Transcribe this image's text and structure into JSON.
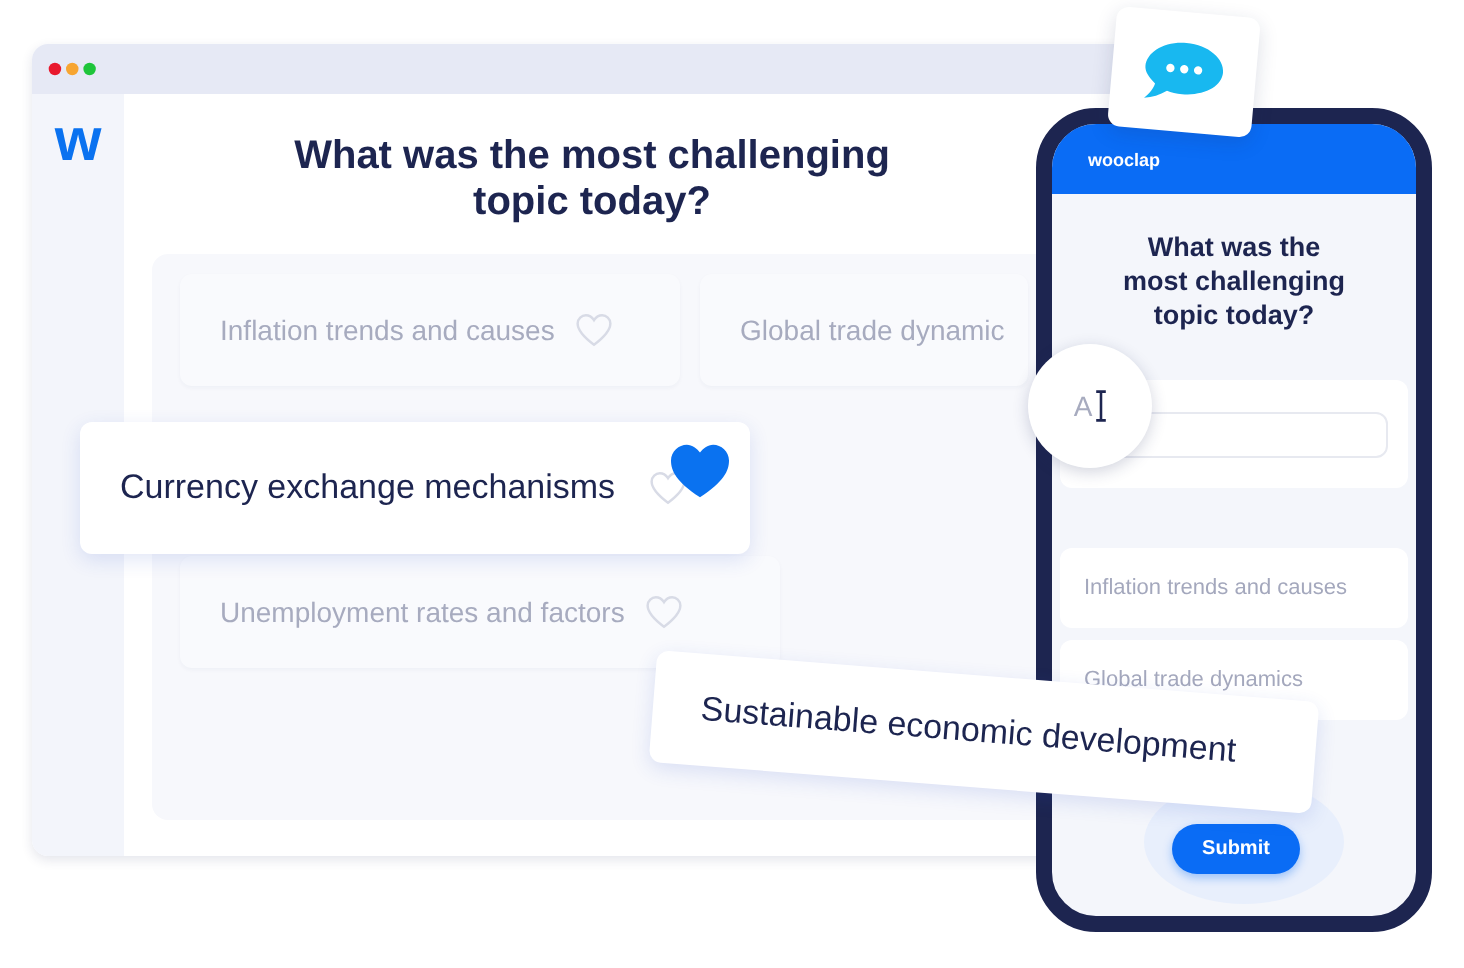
{
  "browser": {
    "logo": "w",
    "question": "What was the most challenging topic today?",
    "answers": [
      {
        "text": "Inflation trends and causes",
        "liked": false
      },
      {
        "text": "Global trade dynamic"
      },
      {
        "text": "Unemployment rates and factors",
        "liked": false
      }
    ]
  },
  "floating_answer": {
    "text": "Currency exchange mechanisms",
    "liked": true
  },
  "dragged_answer": {
    "text": "Sustainable economic development"
  },
  "phone": {
    "brand": "wooclap",
    "question": "What was the most challenging topic today?",
    "typing_lens": {
      "text": "A"
    },
    "options": [
      "Inflation trends and causes",
      "Global trade dynamics"
    ],
    "submit": "Submit"
  }
}
